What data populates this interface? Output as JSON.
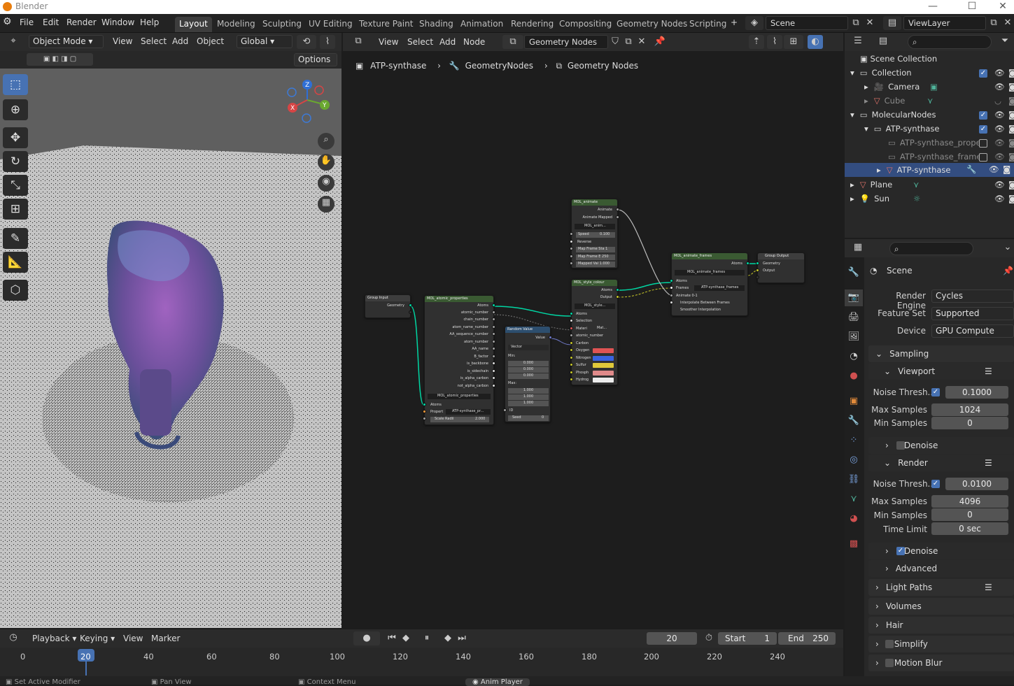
{
  "titlebar": {
    "app": "Blender",
    "minimize": "—",
    "maximize": "☐",
    "close": "✕"
  },
  "menus": [
    "File",
    "Edit",
    "Render",
    "Window",
    "Help"
  ],
  "workspaces": [
    "Layout",
    "Modeling",
    "Sculpting",
    "UV Editing",
    "Texture Paint",
    "Shading",
    "Animation",
    "Rendering",
    "Compositing",
    "Geometry Nodes",
    "Scripting"
  ],
  "add_workspace": "+",
  "scene": {
    "name": "Scene",
    "viewlayer": "ViewLayer"
  },
  "viewport": {
    "mode": "Object Mode",
    "menus": [
      "View",
      "Select",
      "Add",
      "Object"
    ],
    "orientation": "Global",
    "options": "Options",
    "gizmo": {
      "x": "X",
      "y": "Y",
      "z": "Z"
    }
  },
  "node_editor": {
    "menus": [
      "View",
      "Select",
      "Add",
      "Node"
    ],
    "tree_name": "Geometry Nodes",
    "breadcrumb": [
      "ATP-synthase",
      "GeometryNodes",
      "Geometry Nodes"
    ],
    "nodes": {
      "group_input": {
        "title": "Group Input",
        "out": "Geometry"
      },
      "atomic": {
        "title": "MOL_atomic_properties",
        "outputs": [
          "Atoms",
          "atomic_number",
          "chain_number",
          "atom_name_number",
          "AA_sequence_number",
          "atom_number",
          "AA_name",
          "B_factor",
          "is_backbone",
          "is_sidechain",
          "is_alpha_carbon",
          "not_alpha_carbon"
        ],
        "sub": "MOL_atomic_properties",
        "in_atoms": "Atoms",
        "prop_label": "Propert",
        "prop_value": "ATP-synthase_pr...",
        "scale": "Scale Radii",
        "scale_val": "2.000"
      },
      "random": {
        "title": "Random Value",
        "out": "Value",
        "type": "Vector",
        "min": "Min:",
        "min_vals": [
          "0.000",
          "0.000",
          "0.000"
        ],
        "max": "Max:",
        "max_vals": [
          "1.000",
          "1.000",
          "1.000"
        ],
        "id": "ID",
        "seed": "Seed",
        "seed_val": "0"
      },
      "animate": {
        "title": "MOL_animate",
        "outputs": [
          "Animate",
          "Animate Mapped"
        ],
        "sub": "MOL_anim...",
        "speed": "Speed",
        "speed_val": "0.100",
        "reverse": "Reverse",
        "f1": "Map Frame Sta 1",
        "f2": "Map Frame E 250",
        "f3": "Mapped Val 1.000"
      },
      "style": {
        "title": "MOL_style_colour",
        "outputs": [
          "Atoms",
          "Output"
        ],
        "sub": "MOL_style...",
        "inputs": [
          "Atoms",
          "Selection",
          "Materi",
          "atomic_number",
          "Carbon",
          "Oxygen",
          "Nitrogen",
          "Sulfur",
          "Phosph",
          "Hydrog"
        ],
        "mat": "Mat..."
      },
      "frames": {
        "title": "MOL_animate_frames",
        "out": "Atoms",
        "sub": "MOL_animate_frames",
        "inputs": [
          "Atoms",
          "Frames",
          "Animate 0-1"
        ],
        "frames_val": "ATP-synthase_frames",
        "opt1": "Interpolate Between Frames",
        "opt2": "Smoother Interpolation"
      },
      "group_output": {
        "title": "Group Output",
        "inputs": [
          "Geometry",
          "Output"
        ]
      }
    },
    "colors": {
      "oxygen": "#e05454",
      "nitrogen": "#3a63e0",
      "sulfur": "#e0c93a",
      "phosph": "#e08a8a",
      "hydrog": "#ececec"
    }
  },
  "outliner": {
    "root": "Scene Collection",
    "items": [
      {
        "name": "Collection",
        "level": 0
      },
      {
        "name": "Camera",
        "level": 1
      },
      {
        "name": "Cube",
        "level": 1
      },
      {
        "name": "MolecularNodes",
        "level": 0
      },
      {
        "name": "ATP-synthase",
        "level": 1
      },
      {
        "name": "ATP-synthase_prope",
        "level": 2
      },
      {
        "name": "ATP-synthase_frame",
        "level": 2
      },
      {
        "name": "ATP-synthase",
        "level": 2
      },
      {
        "name": "Plane",
        "level": 0
      },
      {
        "name": "Sun",
        "level": 0
      }
    ]
  },
  "properties": {
    "context": "Scene",
    "render_engine_label": "Render Engine",
    "render_engine": "Cycles",
    "feature_set_label": "Feature Set",
    "feature_set": "Supported",
    "device_label": "Device",
    "device": "GPU Compute",
    "sampling": "Sampling",
    "viewport": "Viewport",
    "v_noise_label": "Noise Thresh...",
    "v_noise": "0.1000",
    "v_max_label": "Max Samples",
    "v_max": "1024",
    "v_min_label": "Min Samples",
    "v_min": "0",
    "v_denoise": "Denoise",
    "render": "Render",
    "r_noise_label": "Noise Thresh...",
    "r_noise": "0.0100",
    "r_max_label": "Max Samples",
    "r_max": "4096",
    "r_min_label": "Min Samples",
    "r_min": "0",
    "r_time_label": "Time Limit",
    "r_time": "0 sec",
    "r_denoise": "Denoise",
    "advanced": "Advanced",
    "light_paths": "Light Paths",
    "volumes": "Volumes",
    "hair": "Hair",
    "simplify": "Simplify",
    "motion_blur": "Motion Blur"
  },
  "timeline": {
    "menus": [
      "Playback",
      "Keying",
      "View",
      "Marker"
    ],
    "current_frame": "20",
    "start_label": "Start",
    "start": "1",
    "end_label": "End",
    "end": "250",
    "ticks": [
      "0",
      "20",
      "40",
      "60",
      "80",
      "100",
      "120",
      "140",
      "160",
      "180",
      "200",
      "220",
      "240"
    ]
  },
  "statusbar": [
    "Set Active Modifier",
    "Pan View",
    "Context Menu",
    "Anim Player"
  ]
}
